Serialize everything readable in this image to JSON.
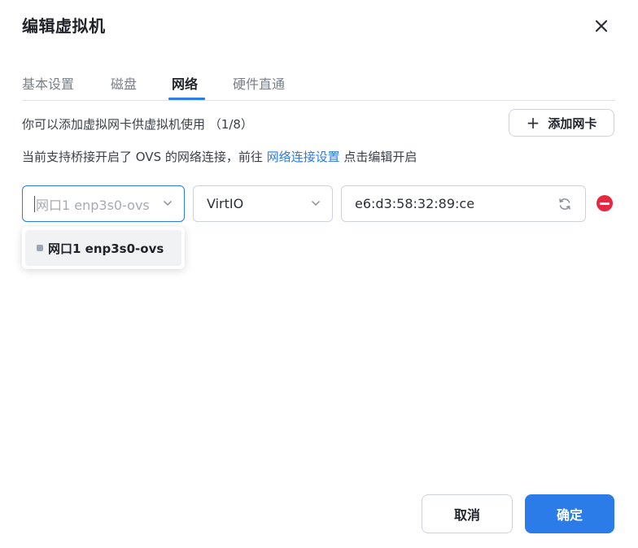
{
  "dialog": {
    "title": "编辑虚拟机"
  },
  "tabs": [
    {
      "label": "基本设置",
      "active": false
    },
    {
      "label": "磁盘",
      "active": false
    },
    {
      "label": "网络",
      "active": true
    },
    {
      "label": "硬件直通",
      "active": false
    }
  ],
  "network": {
    "hint": "你可以添加虚拟网卡供虚拟机使用 （1/8）",
    "add_label": "添加网卡",
    "ovs_text_before": "当前支持桥接开启了 OVS 的网络连接，前往 ",
    "ovs_link": "网络连接设置",
    "ovs_text_after": " 点击编辑开启",
    "nic_row": {
      "interface_placeholder": "网口1 enp3s0-ovs",
      "model": "VirtIO",
      "mac": "e6:d3:58:32:89:ce"
    },
    "dropdown_options": [
      {
        "label": "网口1 enp3s0-ovs"
      }
    ]
  },
  "footer": {
    "cancel_label": "取消",
    "ok_label": "确定"
  },
  "colors": {
    "accent": "#2b7be8",
    "danger": "#e5283f"
  }
}
